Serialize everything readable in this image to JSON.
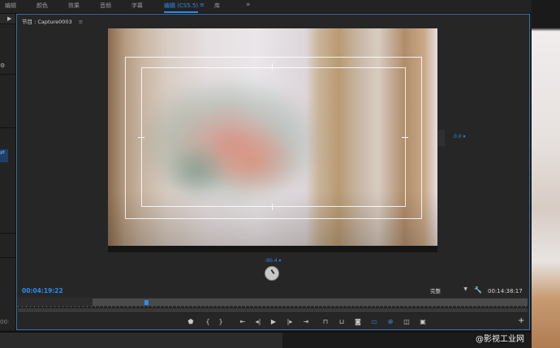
{
  "workspace_tabs": [
    {
      "label": "编辑",
      "active": false
    },
    {
      "label": "颜色",
      "active": false
    },
    {
      "label": "效果",
      "active": false
    },
    {
      "label": "音频",
      "active": false
    },
    {
      "label": "字幕",
      "active": false
    },
    {
      "label": "编辑 (CS5.5)",
      "active": true
    },
    {
      "label": "库",
      "active": false
    }
  ],
  "workspace_menu_glyph": "≡",
  "workspace_more": "»",
  "monitor": {
    "title": "节目 : Capture0003",
    "menu_glyph": "≡",
    "right_value": "0.0 ▾",
    "bottom_value": "-90.4 ▾",
    "current_timecode": "00:04:19:22",
    "duration_timecode": "00:14:38:17",
    "fit_value": "完整",
    "playhead_progress": 0.12
  },
  "left_panel": {
    "play_glyph": "▶",
    "timecode_fragment": "00:"
  },
  "transport_controls": [
    {
      "name": "add-marker-button",
      "glyph": "⬟"
    },
    {
      "name": "mark-in-button",
      "glyph": "{"
    },
    {
      "name": "mark-out-button",
      "glyph": "}"
    },
    {
      "name": "go-to-in-button",
      "glyph": "⇤"
    },
    {
      "name": "step-back-button",
      "glyph": "◂|"
    },
    {
      "name": "play-button",
      "glyph": "▶"
    },
    {
      "name": "step-forward-button",
      "glyph": "|▸"
    },
    {
      "name": "go-to-out-button",
      "glyph": "⇥"
    },
    {
      "name": "lift-button",
      "glyph": "⊓"
    },
    {
      "name": "extract-button",
      "glyph": "⊔"
    },
    {
      "name": "export-frame-button",
      "glyph": "◙"
    },
    {
      "name": "safe-margins-button",
      "glyph": "▭"
    },
    {
      "name": "vr-video-button",
      "glyph": "⊕"
    },
    {
      "name": "comparison-view-button",
      "glyph": "◫"
    },
    {
      "name": "multi-camera-button",
      "glyph": "▣"
    }
  ],
  "add_button_glyph": "+",
  "watermark": "@影视工业网",
  "colors": {
    "accent": "#2d8ceb",
    "panel": "#262626",
    "background": "#1d1d1d"
  }
}
